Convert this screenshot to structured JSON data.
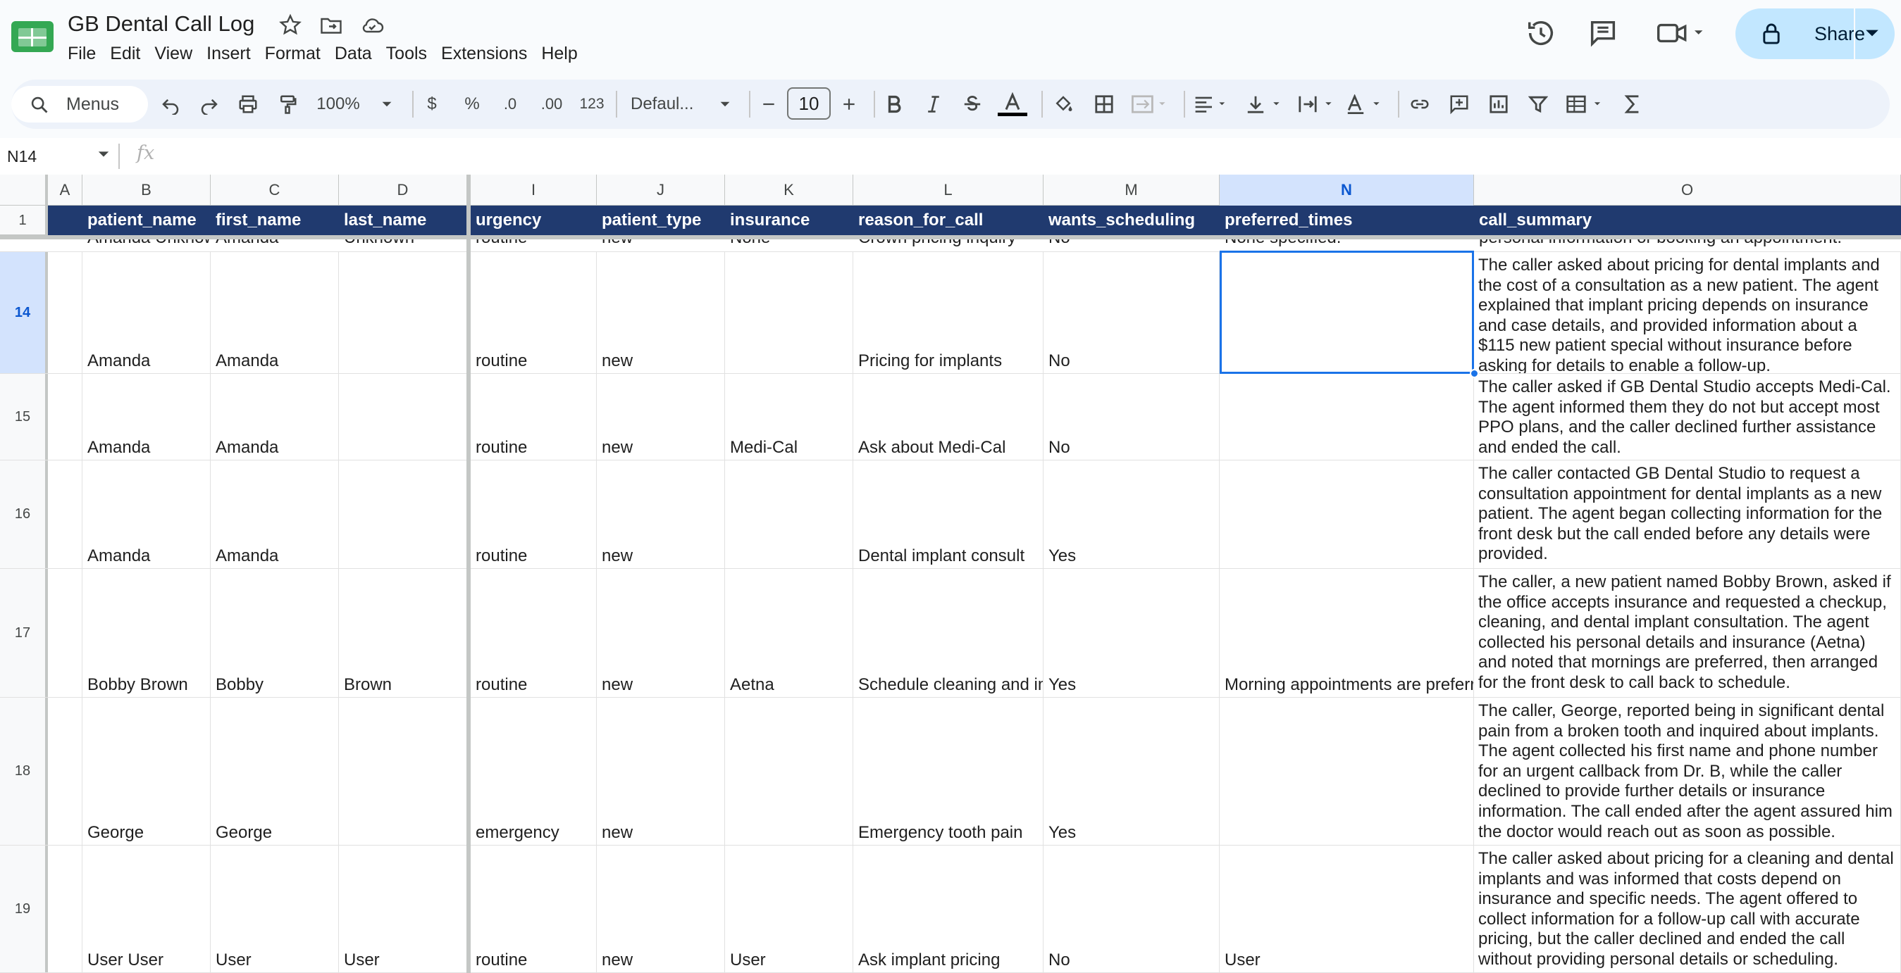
{
  "app": {
    "title": "GB Dental Call Log"
  },
  "menu": [
    "File",
    "Edit",
    "View",
    "Insert",
    "Format",
    "Data",
    "Tools",
    "Extensions",
    "Help"
  ],
  "header": {
    "share_label": "Share"
  },
  "toolbar": {
    "menus_label": "Menus",
    "zoom": "100%",
    "currency": "$",
    "percent": "%",
    "dec_less": ".0",
    "dec_more": ".00",
    "number_format": "123",
    "font": "Defaul...",
    "font_size": "10"
  },
  "formula_bar": {
    "cell_ref": "N14",
    "fx": "fx",
    "value": ""
  },
  "columns": [
    "A",
    "B",
    "C",
    "D",
    "I",
    "J",
    "K",
    "L",
    "M",
    "N",
    "O"
  ],
  "selected_column": "N",
  "header_row": {
    "row_number": "1",
    "cells": [
      "",
      "patient_name",
      "first_name",
      "last_name",
      "urgency",
      "patient_type",
      "insurance",
      "reason_for_call",
      "wants_scheduling",
      "preferred_times",
      "call_summary"
    ]
  },
  "partial_row": {
    "cells": [
      "",
      "Amanda Unknown",
      "Amanda",
      "Unknown",
      "routine",
      "new",
      "None",
      "Crown pricing inquiry",
      "No",
      "None specified.",
      "personal information or booking an appointment."
    ]
  },
  "rows": [
    {
      "number": "14",
      "cells": [
        "",
        "Amanda",
        "Amanda",
        "",
        "routine",
        "new",
        "",
        "Pricing for implants",
        "No",
        "",
        "The caller asked about pricing for dental implants and the cost of a consultation as a new patient. The agent explained that implant pricing depends on insurance and case details, and provided information about a $115 new patient special without insurance before asking for details to enable a follow-up."
      ]
    },
    {
      "number": "15",
      "cells": [
        "",
        "Amanda",
        "Amanda",
        "",
        "routine",
        "new",
        "Medi-Cal",
        "Ask about Medi-Cal",
        "No",
        "",
        "The caller asked if GB Dental Studio accepts Medi-Cal. The agent informed them they do not but accept most PPO plans, and the caller declined further assistance and ended the call."
      ]
    },
    {
      "number": "16",
      "cells": [
        "",
        "Amanda",
        "Amanda",
        "",
        "routine",
        "new",
        "",
        "Dental implant consult",
        "Yes",
        "",
        "The caller contacted GB Dental Studio to request a consultation appointment for dental implants as a new patient. The agent began collecting information for the front desk but the call ended before any details were provided."
      ]
    },
    {
      "number": "17",
      "cells": [
        "",
        "Bobby Brown",
        "Bobby",
        "Brown",
        "routine",
        "new",
        "Aetna",
        "Schedule cleaning and implant consult",
        "Yes",
        "Morning appointments are preferred.",
        "The caller, a new patient named Bobby Brown, asked if the office accepts insurance and requested a checkup, cleaning, and dental implant consultation. The agent collected his personal details and insurance (Aetna) and noted that mornings are preferred, then arranged for the front desk to call back to schedule."
      ]
    },
    {
      "number": "18",
      "cells": [
        "",
        "George",
        "George",
        "",
        "emergency",
        "new",
        "",
        "Emergency tooth pain",
        "Yes",
        "",
        "The caller, George, reported being in significant dental pain from a broken tooth and inquired about implants. The agent collected his first name and phone number for an urgent callback from Dr. B, while the caller declined to provide further details or insurance information. The call ended after the agent assured him the doctor would reach out as soon as possible."
      ]
    },
    {
      "number": "19",
      "cells": [
        "",
        "User User",
        "User",
        "User",
        "routine",
        "new",
        "User",
        "Ask implant pricing",
        "No",
        "User",
        "The caller asked about pricing for a cleaning and dental implants and was informed that costs depend on insurance and specific needs. The agent offered to collect information for a follow-up call with accurate pricing, but the caller declined and ended the call without providing personal details or scheduling."
      ]
    }
  ],
  "colors": {
    "header_fill": "#203a6f",
    "accent": "#1a73e8",
    "share_bg": "#c2e7ff"
  },
  "icons": [
    "sheets-logo-icon",
    "star-icon",
    "move-folder-icon",
    "cloud-status-icon",
    "history-icon",
    "comment-icon",
    "meet-icon",
    "lock-icon",
    "search-icon",
    "undo-icon",
    "redo-icon",
    "print-icon",
    "paint-format-icon",
    "bold-icon",
    "italic-icon",
    "strikethrough-icon",
    "text-color-icon",
    "fill-color-icon",
    "borders-icon",
    "merge-icon",
    "align-icon",
    "valign-icon",
    "wrap-icon",
    "rotate-icon",
    "link-icon",
    "comment-add-icon",
    "chart-icon",
    "filter-icon",
    "table-icon",
    "functions-icon"
  ]
}
